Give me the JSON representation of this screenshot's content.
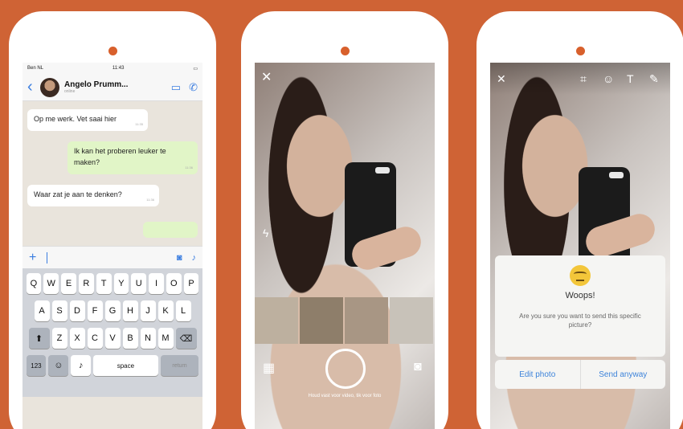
{
  "chat": {
    "status": {
      "carrier": "Ben NL",
      "time": "11:43",
      "battery": ""
    },
    "contact_name": "Angelo Prumm...",
    "contact_sub": "online",
    "messages": [
      {
        "text": "Op me werk. Vet saai hier",
        "time": "11:35"
      },
      {
        "text": "Ik kan het proberen leuker te maken?",
        "time": "11:36"
      },
      {
        "text": "Waar zat je aan te denken?",
        "time": "11:36"
      }
    ],
    "keyboard": {
      "row1": [
        "Q",
        "W",
        "E",
        "R",
        "T",
        "Y",
        "U",
        "I",
        "O",
        "P"
      ],
      "row2": [
        "A",
        "S",
        "D",
        "F",
        "G",
        "H",
        "J",
        "K",
        "L"
      ],
      "row3": [
        "Z",
        "X",
        "C",
        "V",
        "B",
        "N",
        "M"
      ],
      "num_key": "123",
      "space": "space",
      "return": "return"
    }
  },
  "camera": {
    "hint": "Houd vast voor video, tik voor foto"
  },
  "warning": {
    "title": "Woops!",
    "message": "Are you sure you want to send this specific picture?",
    "edit_label": "Edit photo",
    "send_label": "Send anyway"
  },
  "colors": {
    "background": "#cf6335",
    "accent": "#3a7de0"
  }
}
